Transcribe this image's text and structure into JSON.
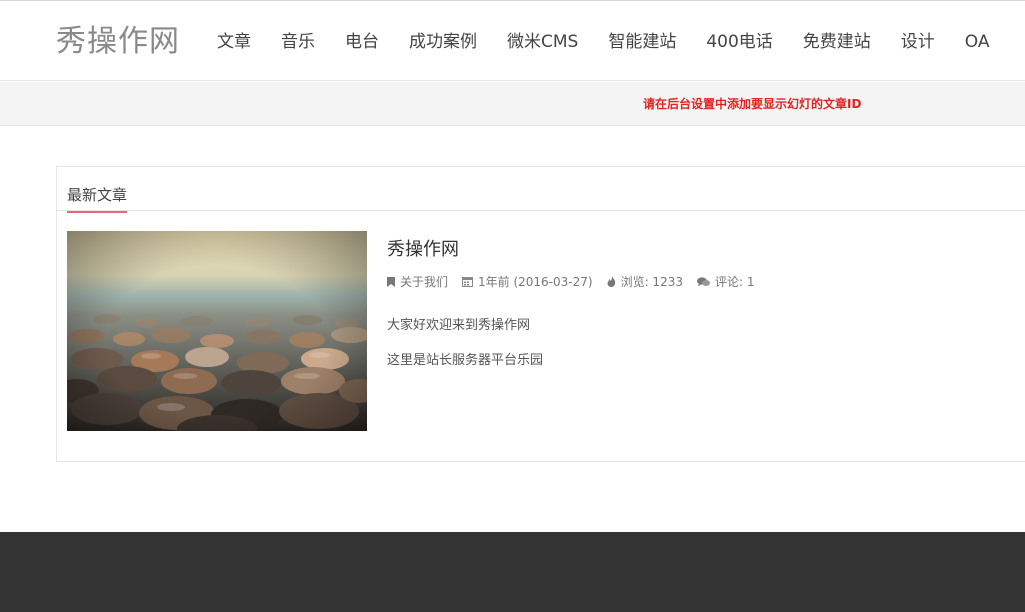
{
  "site": {
    "logo": "秀操作网"
  },
  "nav": {
    "items": [
      "文章",
      "音乐",
      "电台",
      "成功案例",
      "微米CMS",
      "智能建站",
      "400电话",
      "免费建站",
      "设计",
      "OA"
    ]
  },
  "banner": {
    "message": "请在后台设置中添加要显示幻灯的文章ID"
  },
  "latest": {
    "heading": "最新文章",
    "post": {
      "title": "秀操作网",
      "category": "关于我们",
      "date": "1年前 (2016-03-27)",
      "views": "浏览: 1233",
      "comments": "评论: 1",
      "excerpt_line1": "大家好欢迎来到秀操作网",
      "excerpt_line2": "这里是站长服务器平台乐园"
    }
  },
  "colors": {
    "accent_underline": "#e26b79",
    "banner_text": "#e52222",
    "footer_bg": "#333333"
  },
  "icons": {
    "category": "bookmark-icon",
    "date": "calendar-icon",
    "views": "flame-icon",
    "comments": "comments-icon"
  }
}
